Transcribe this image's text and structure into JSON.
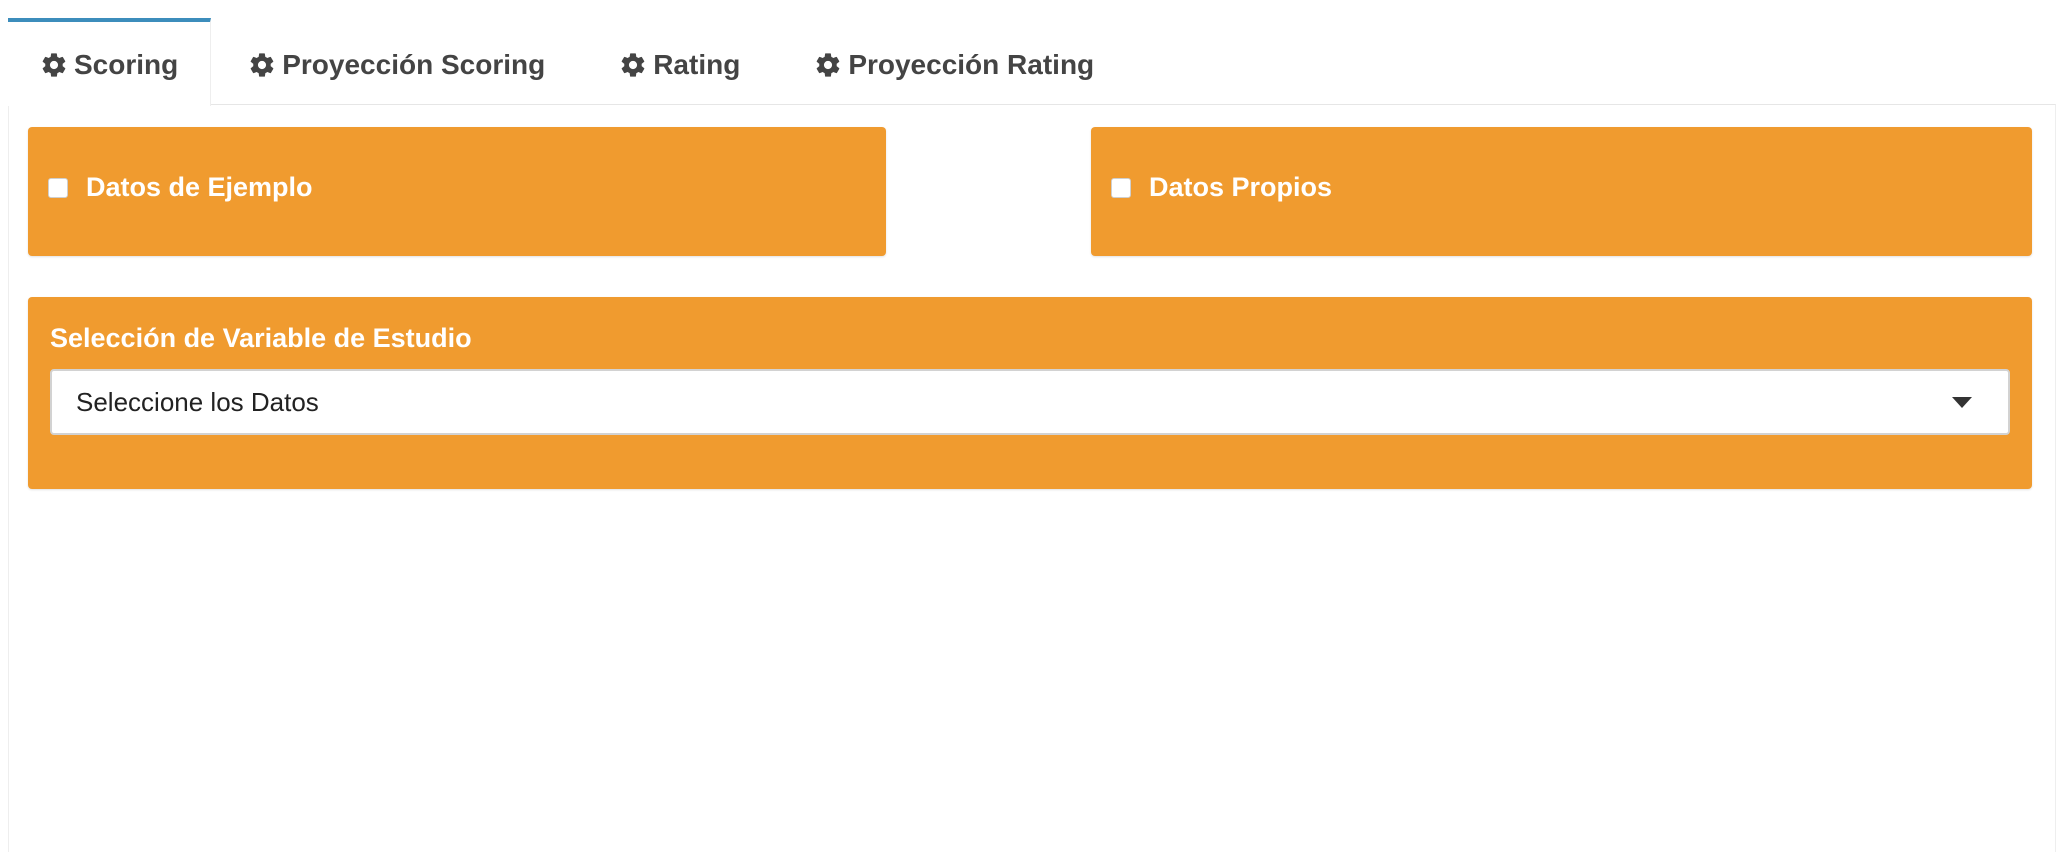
{
  "tabs": [
    {
      "label": "Scoring",
      "icon": "gear-icon",
      "active": true
    },
    {
      "label": "Proyección Scoring",
      "icon": "gear-icon",
      "active": false
    },
    {
      "label": "Rating",
      "icon": "gear-icon",
      "active": false
    },
    {
      "label": "Proyección Rating",
      "icon": "gear-icon",
      "active": false
    }
  ],
  "options": {
    "example_data_label": "Datos de Ejemplo",
    "own_data_label": "Datos Propios"
  },
  "variable_selection": {
    "title": "Selección de Variable de Estudio",
    "selected_value": "Seleccione los Datos"
  },
  "colors": {
    "box_orange": "#f09b2f",
    "active_tab_accent": "#3c8dbc",
    "tab_text": "#444444"
  }
}
